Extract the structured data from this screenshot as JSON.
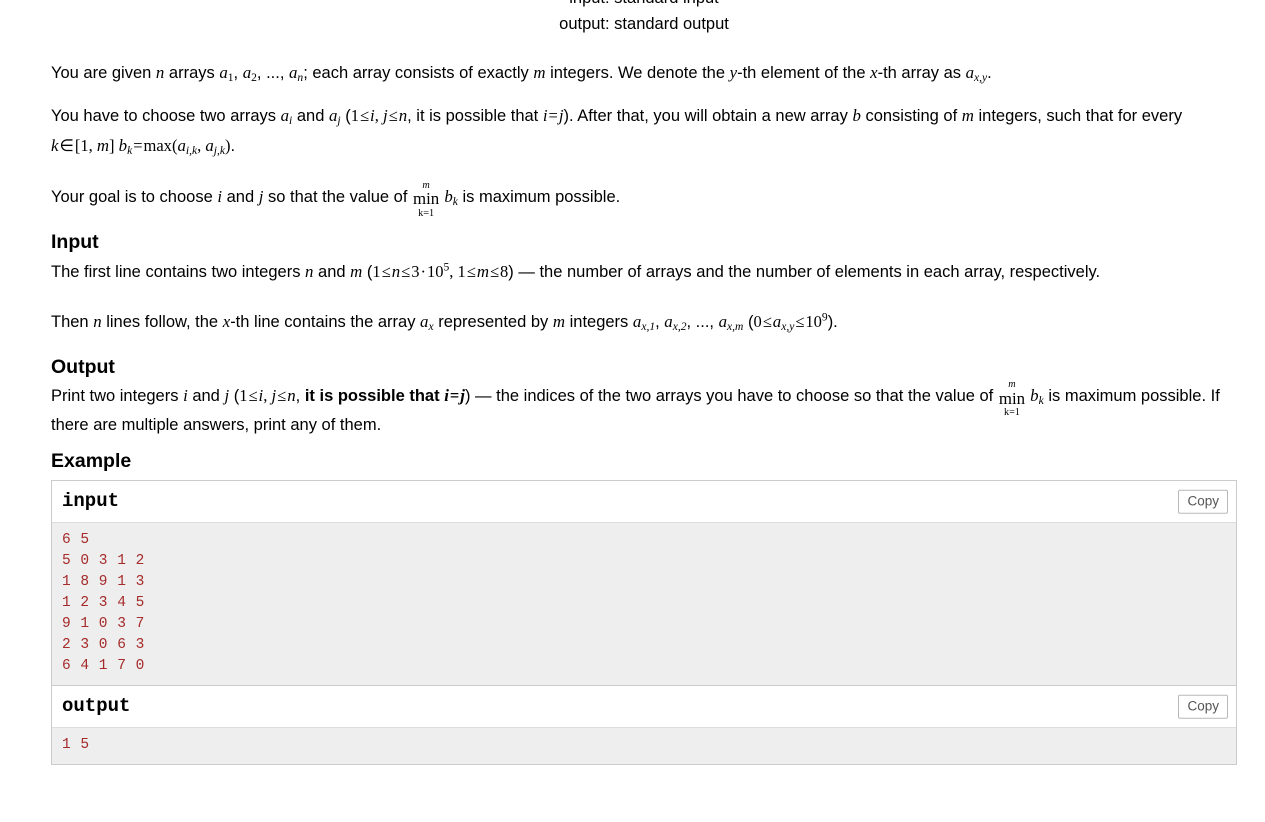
{
  "problem_specs": {
    "input_spec": "input: standard input",
    "output_spec": "output: standard output"
  },
  "statement": {
    "p1": {
      "t1": "You are given ",
      "n": "n",
      "t2": " arrays ",
      "a": "a",
      "s1": "1",
      "c1": ", ",
      "s2": "2",
      "c2": ", ..., ",
      "sn": "n",
      "t3": "; each array consists of exactly ",
      "m": "m",
      "t4": " integers. We denote the ",
      "y": "y",
      "t5": "-th element of the ",
      "x": "x",
      "t6": "-th array as ",
      "sxy": "x,y",
      "t7": "."
    },
    "p2": {
      "t1": "You have to choose two arrays ",
      "a": "a",
      "si": "i",
      "t2": " and ",
      "sj": "j",
      "t3": " (",
      "one": "1",
      "le": "≤",
      "i": "i",
      "comma": ", ",
      "j": "j",
      "n": "n",
      "t4": ", it is possible that ",
      "eq": "=",
      "t5": "). After that, you will obtain a new array ",
      "b": "b",
      "t6": " consisting of ",
      "m": "m",
      "t7": " integers, such that for every ",
      "k": "k",
      "in": "∈",
      "lb": "[",
      "rb": "]",
      "bk_b": "b",
      "bk_s": "k",
      "max": "max",
      "aik": "i,k",
      "ajk": "j,k",
      "t8": "."
    },
    "p3": {
      "t1": "Your goal is to choose ",
      "i": "i",
      "t2": " and ",
      "j": "j",
      "t3": " so that the value of ",
      "min_op": "min",
      "min_top": "m",
      "min_bot": "k=1",
      "b": "b",
      "bsub": "k",
      "t4": " is maximum possible."
    }
  },
  "input_section": {
    "heading": "Input",
    "p1": {
      "t1": "The first line contains two integers ",
      "n": "n",
      "t2": " and ",
      "m": "m",
      "t3": " (",
      "one": "1",
      "le": "≤",
      "three": "3",
      "cdot": "·",
      "ten": "10",
      "sup5": "5",
      "comma": ", ",
      "eight": "8",
      "t4": ") — the number of arrays and the number of elements in each array, respectively."
    },
    "p2": {
      "t1": "Then ",
      "n": "n",
      "t2": " lines follow, the ",
      "x": "x",
      "t3": "-th line contains the array ",
      "a": "a",
      "sx": "x",
      "t4": " represented by ",
      "m": "m",
      "t5": " integers ",
      "sx1": "x,1",
      "c1": ", ",
      "sx2": "x,2",
      "c2": ", ..., ",
      "sxm": "x,m",
      "t6": " (",
      "zero": "0",
      "le": "≤",
      "sxy": "x,y",
      "ten": "10",
      "sup9": "9",
      "t7": ")."
    }
  },
  "output_section": {
    "heading": "Output",
    "p1": {
      "t1": "Print two integers ",
      "i": "i",
      "t2": " and ",
      "j": "j",
      "t3": " (",
      "one": "1",
      "le": "≤",
      "comma": ", ",
      "n": "n",
      "t4": ", ",
      "bold": "it is possible that ",
      "eq": "=",
      "t5": ") — the indices of the two arrays you have to choose so that the value of ",
      "min_op": "min",
      "min_top": "m",
      "min_bot": "k=1",
      "b": "b",
      "bsub": "k",
      "t6": " is maximum possible. If there are multiple answers, print any of them."
    }
  },
  "example_section": {
    "heading": "Example",
    "input_box": {
      "title": "input",
      "copy_label": "Copy",
      "data": "6 5\n5 0 3 1 2\n1 8 9 1 3\n1 2 3 4 5\n9 1 0 3 7\n2 3 0 6 3\n6 4 1 7 0"
    },
    "output_box": {
      "title": "output",
      "copy_label": "Copy",
      "data": "1 5"
    }
  },
  "colors": {
    "sample_text": "#a52a2a",
    "sample_bg": "#eeeeee",
    "border": "#ccccce"
  }
}
